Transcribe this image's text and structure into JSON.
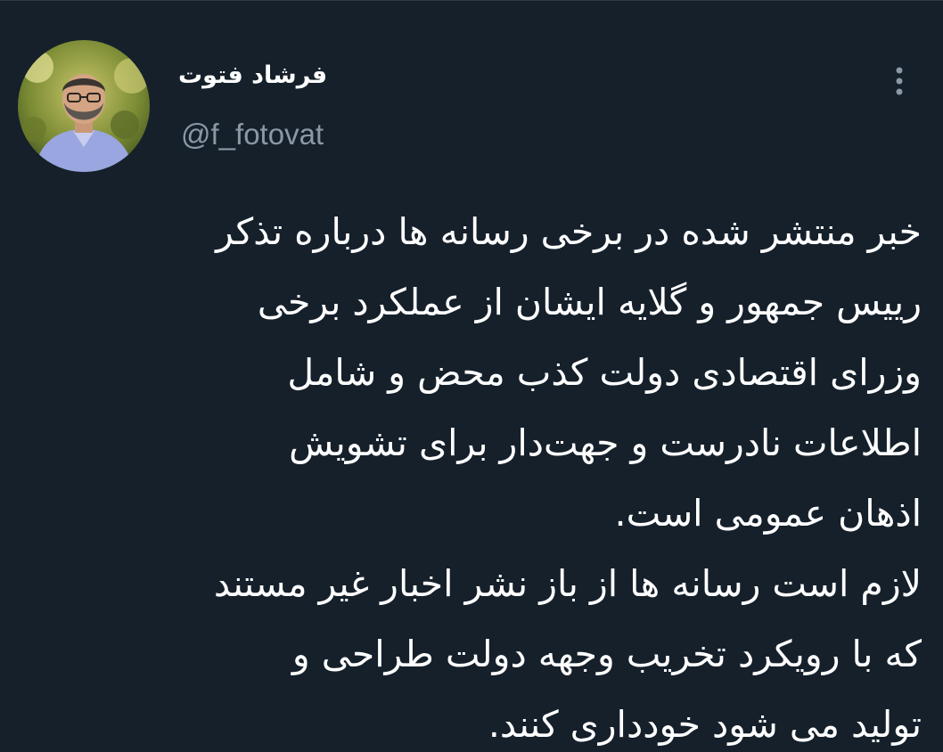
{
  "author": {
    "display_name": "فرشاد فتوت",
    "handle": "@f_fotovat"
  },
  "icons": {
    "more": "more-vertical-icon",
    "avatar": "profile-photo"
  },
  "colors": {
    "background": "#15202b",
    "text_primary": "#ffffff",
    "text_secondary": "#8b98a5"
  },
  "tweet": {
    "lines": [
      "خبر منتشر شده در برخی رسانه ها درباره تذکر",
      "رییس جمهور و گلایه ایشان از عملکرد برخی",
      "وزرای اقتصادی دولت کذب محض و شامل",
      "اطلاعات نادرست و جهت‌دار برای تشویش",
      "اذهان عمومی است.",
      "لازم است رسانه ها از باز نشر اخبار غیر مستند",
      "که با رویکرد تخریب وجهه دولت طراحی و",
      "تولید می شود خودداری کنند."
    ]
  }
}
